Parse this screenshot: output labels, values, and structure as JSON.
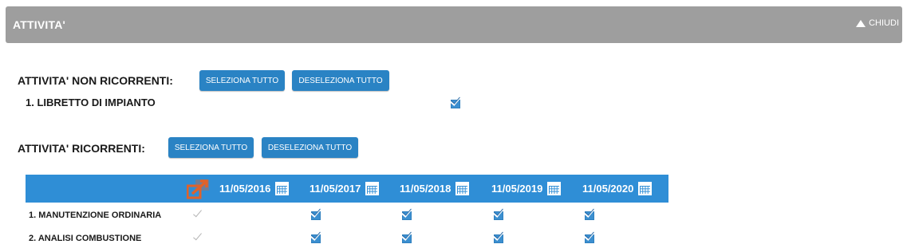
{
  "panel": {
    "title": "ATTIVITA'",
    "close_label": "CHIUDI"
  },
  "non_recurring": {
    "label": "ATTIVITA' NON RICORRENTI:",
    "select_all": "SELEZIONA TUTTO",
    "deselect_all": "DESELEZIONA TUTTO",
    "items": [
      {
        "label": "1. LIBRETTO DI IMPIANTO",
        "checked": true
      }
    ]
  },
  "recurring": {
    "label": "ATTIVITA' RICORRENTI:",
    "select_all": "SELEZIONA TUTTO",
    "deselect_all": "DESELEZIONA TUTTO",
    "dates": [
      "11/05/2016",
      "11/05/2017",
      "11/05/2018",
      "11/05/2019",
      "11/05/2020"
    ],
    "rows": [
      {
        "label": "1. MANUTENZIONE ORDINARIA",
        "row_toggle": "disabled-checked",
        "checks": [
          true,
          true,
          true,
          true
        ]
      },
      {
        "label": "2. ANALISI COMBUSTIONE",
        "row_toggle": "disabled-checked",
        "checks": [
          true,
          true,
          true,
          true
        ]
      }
    ]
  },
  "colors": {
    "header_grey": "#9e9e9e",
    "button_blue": "#2a83c4",
    "table_header_blue": "#2f8ed6",
    "expand_icon_orange": "#e0622a"
  },
  "icons": {
    "collapse": "triangle-up-icon",
    "calendar": "calendar-icon",
    "expand": "expand-arrows-icon",
    "checkbox": "checkbox-checked-icon"
  }
}
